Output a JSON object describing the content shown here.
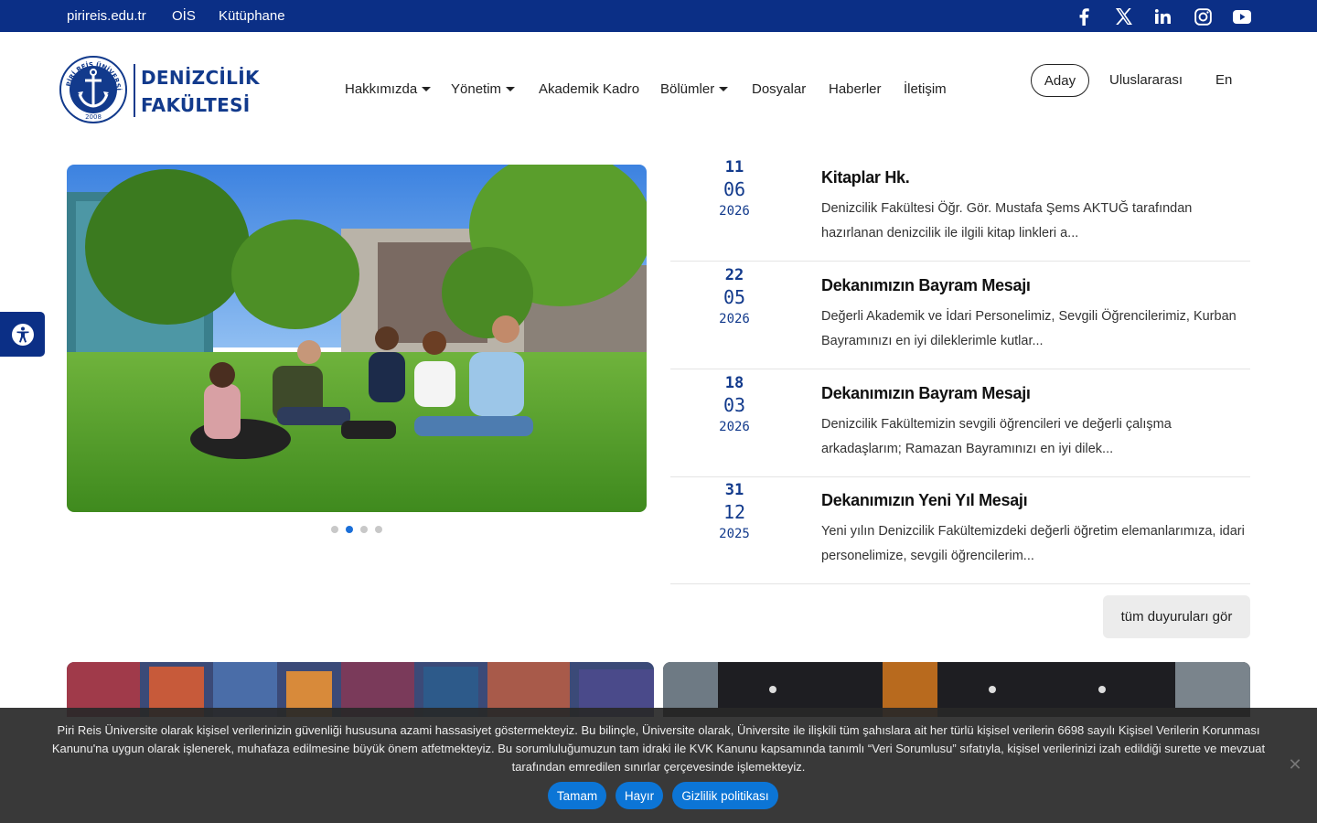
{
  "topbar": {
    "links": [
      "pirireis.edu.tr",
      "OİS",
      "Kütüphane"
    ],
    "social": [
      "facebook-icon",
      "x-icon",
      "linkedin-icon",
      "instagram-icon",
      "youtube-icon"
    ]
  },
  "logo": {
    "line1": "DENİZCİLİK",
    "line2": "FAKÜLTESİ",
    "seal_text": "PİRİ REİS ÜNİVERSİTESİ",
    "seal_year": "2008"
  },
  "nav": {
    "items": [
      "Hakkımızda",
      "Yönetim",
      "Akademik Kadro",
      "Bölümler",
      "Dosyalar",
      "Haberler",
      "İletişim"
    ]
  },
  "header_right": {
    "aday": "Aday",
    "international": "Uluslararası",
    "lang": "En"
  },
  "news": [
    {
      "day": "11",
      "month": "06",
      "year": "2026",
      "title": "Kitaplar Hk.",
      "desc": "Denizcilik Fakültesi Öğr. Gör. Mustafa Şems AKTUĞ tarafından hazırlanan denizcilik ile ilgili kitap linkleri a..."
    },
    {
      "day": "22",
      "month": "05",
      "year": "2026",
      "title": "Dekanımızın Bayram Mesajı",
      "desc": "Değerli Akademik ve İdari Personelimiz, Sevgili Öğrencilerimiz, Kurban Bayramınızı en iyi dileklerimle kutlar..."
    },
    {
      "day": "18",
      "month": "03",
      "year": "2026",
      "title": "Dekanımızın Bayram Mesajı",
      "desc": "Denizcilik Fakültemizin sevgili öğrencileri ve değerli çalışma arkadaşlarım; Ramazan Bayramınızı en iyi dilek..."
    },
    {
      "day": "31",
      "month": "12",
      "year": "2025",
      "title": "Dekanımızın Yeni Yıl Mesajı",
      "desc": "Yeni yılın Denizcilik Fakültemizdeki değerli öğretim elemanlarımıza, idari personelimize, sevgili öğrencilerim..."
    }
  ],
  "all_announcements": "tüm duyuruları gör",
  "cookie": {
    "text": "Piri Reis Üniversite olarak kişisel verilerinizin güvenliği hususuna azami hassasiyet göstermekteyiz. Bu bilinçle, Üniversite olarak, Üniversite ile ilişkili tüm şahıslara ait her türlü kişisel verilerin 6698 sayılı Kişisel Verilerin Korunması Kanunu'na uygun olarak işlenerek, muhafaza edilmesine büyük önem atfetmekteyiz. Bu sorumluluğumuzun tam idraki ile KVK Kanunu kapsamında tanımlı “Veri Sorumlusu” sıfatıyla, kişisel verilerinizi izah edildiği surette ve mevzuat tarafından emredilen sınırlar çerçevesinde işlemekteyiz.",
    "accept": "Tamam",
    "reject": "Hayır",
    "policy": "Gizlilik politikası"
  },
  "slider": {
    "slide_count": 4,
    "active_slide": 2
  }
}
